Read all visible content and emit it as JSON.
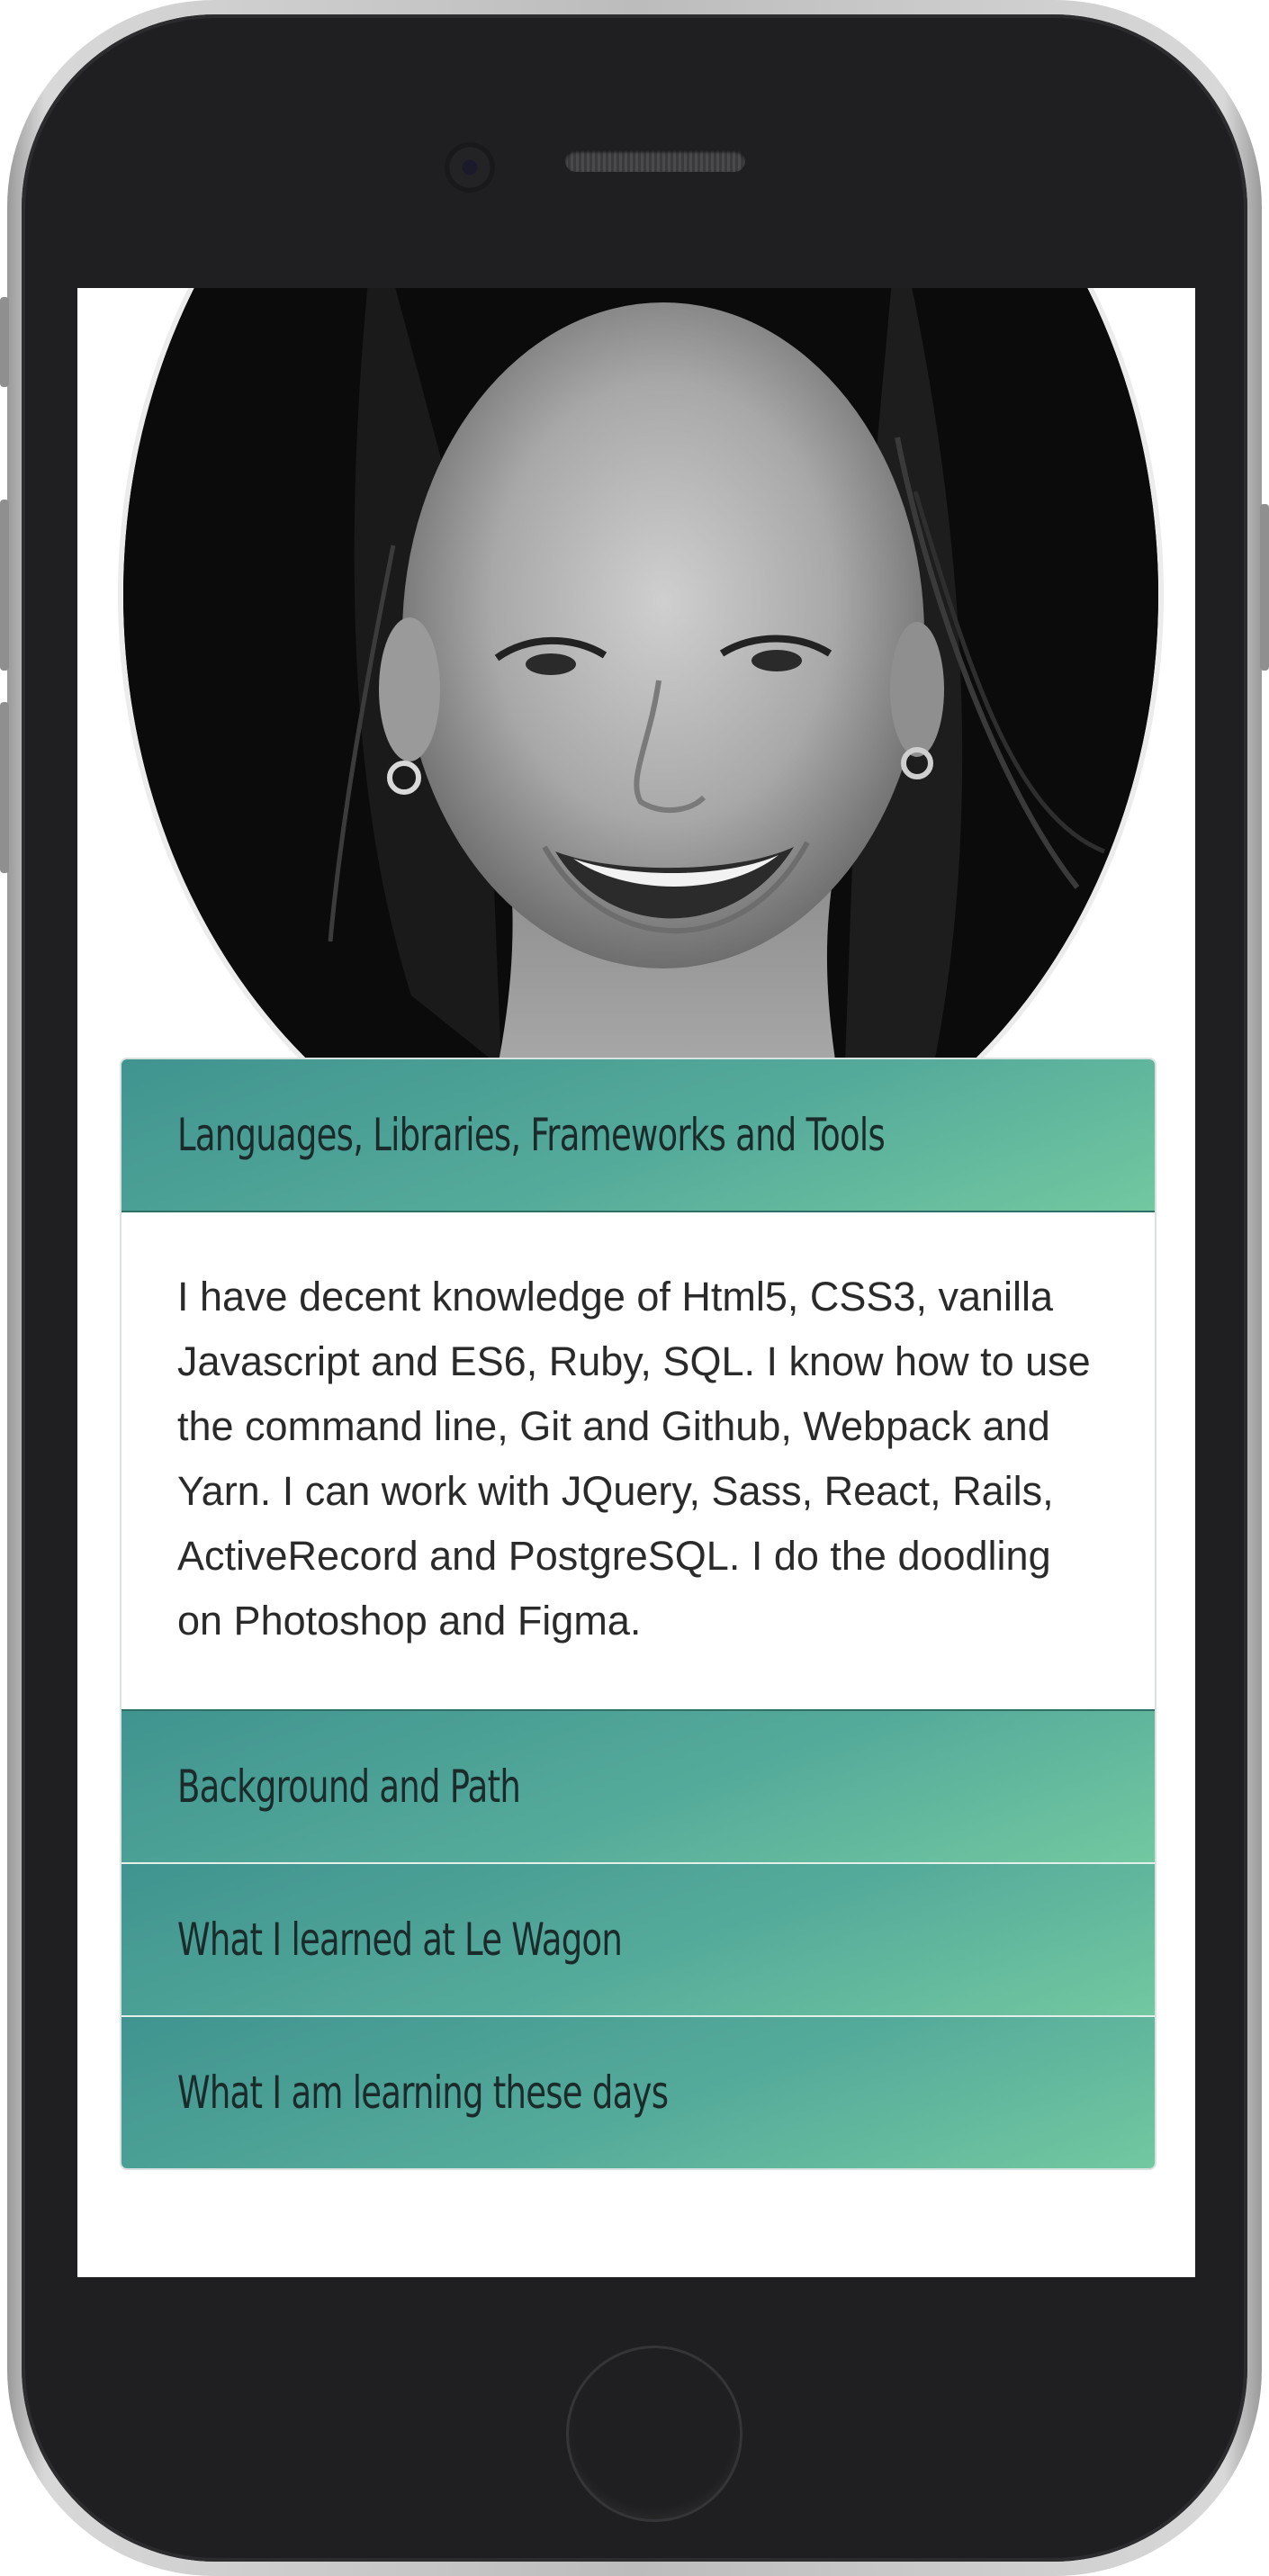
{
  "accordion": {
    "sections": [
      {
        "title": "Languages, Libraries, Frameworks and Tools",
        "expanded": true,
        "body": "I have decent knowledge of Html5, CSS3, vanilla Javascript and ES6, Ruby, SQL. I know how to use the command line, Git and Github, Webpack and Yarn. I can work with JQuery, Sass, React, Rails, ActiveRecord and PostgreSQL. I do the doodling on Photoshop and Figma."
      },
      {
        "title": "Background and Path",
        "expanded": false
      },
      {
        "title": "What I learned at Le Wagon",
        "expanded": false
      },
      {
        "title": "What I am learning these days",
        "expanded": false
      }
    ]
  },
  "colors": {
    "header_gradient_start": "#409490",
    "header_gradient_end": "#72c8a0",
    "header_text": "#1b2a2a",
    "body_text": "#2a2a2a",
    "device_frame": "#1f1f21"
  },
  "icons": {
    "profile_photo": "portrait-photo"
  }
}
